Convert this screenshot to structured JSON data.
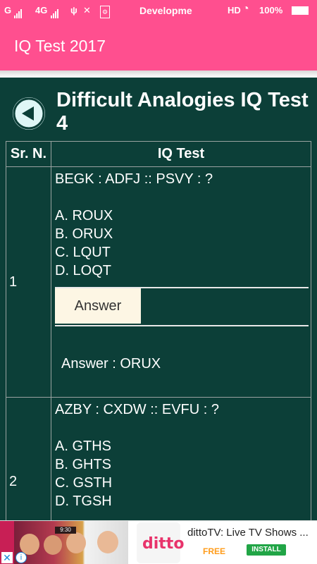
{
  "status_bar": {
    "carrier": "G",
    "network": "4G",
    "center_text": "Developme",
    "hd": "HD",
    "battery": "100%",
    "icons": [
      "signal-icon",
      "usb-icon",
      "tools-icon",
      "debug-icon",
      "wifi-icon",
      "battery-icon"
    ]
  },
  "app_bar": {
    "title": "IQ Test 2017"
  },
  "page": {
    "title": "Difficult Analogies IQ Test 4"
  },
  "table": {
    "headers": {
      "sr": "Sr. N.",
      "test": "IQ Test"
    },
    "rows": [
      {
        "number": "1",
        "question": "BEGK : ADFJ :: PSVY : ?",
        "options": [
          "A. ROUX",
          "B. ORUX",
          "C. LQUT",
          "D. LOQT"
        ],
        "answer_button": "Answer",
        "answer_text": "Answer : ORUX"
      },
      {
        "number": "2",
        "question": "AZBY : CXDW :: EVFU : ?",
        "options": [
          "A. GTHS",
          "B. GHTS",
          "C. GSTH",
          "D. TGSH"
        ]
      }
    ]
  },
  "ad": {
    "title": "dittoTV: Live TV Shows ...",
    "logo_text": "ditto",
    "price": "FREE",
    "install": "INSTALL",
    "clock": "9:30"
  },
  "colors": {
    "primary": "#ff4f8f",
    "content_bg": "#0c3f38",
    "answer_button_bg": "#fdf6e4"
  }
}
